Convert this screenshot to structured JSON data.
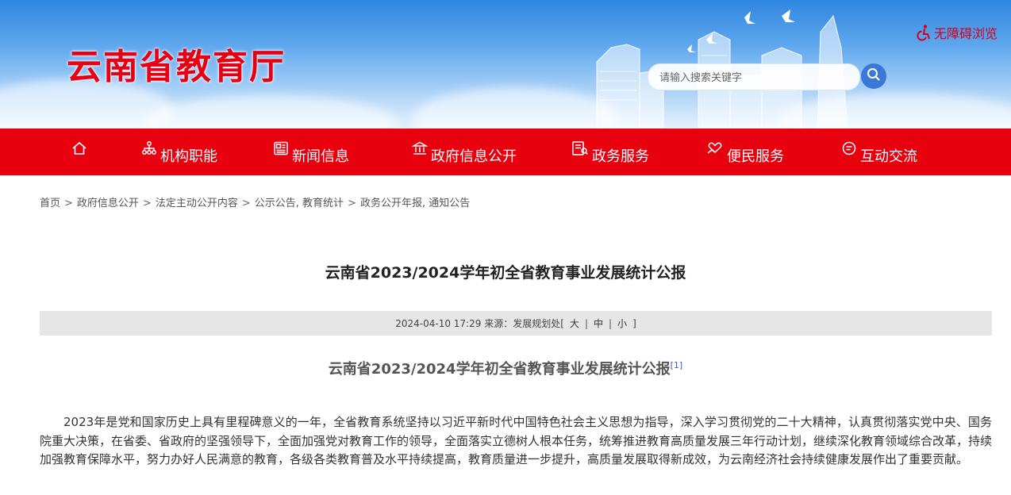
{
  "header": {
    "site_title": "云南省教育厅",
    "accessibility_label": "无障碍浏览",
    "search": {
      "placeholder": "请输入搜索关键字"
    }
  },
  "nav": {
    "items": [
      {
        "label": "",
        "icon": "home-icon"
      },
      {
        "label": "机构职能",
        "icon": "org-chart-icon"
      },
      {
        "label": "新闻信息",
        "icon": "news-icon"
      },
      {
        "label": "政府信息公开",
        "icon": "government-building-icon"
      },
      {
        "label": "政务服务",
        "icon": "service-document-icon"
      },
      {
        "label": "便民服务",
        "icon": "heart-hand-icon"
      },
      {
        "label": "互动交流",
        "icon": "chat-icon"
      }
    ]
  },
  "breadcrumb": {
    "separator": ">",
    "items": [
      "首页",
      "政府信息公开",
      "法定主动公开内容",
      "公示公告, 教育统计",
      "政务公开年报, 通知公告"
    ]
  },
  "article": {
    "title": "云南省2023/2024学年初全省教育事业发展统计公报",
    "meta": {
      "datetime": "2024-04-10 17:29",
      "source_label": "来源：",
      "source": "发展规划处",
      "font_bracket_open": "[",
      "font_large": "大",
      "font_medium": "中",
      "font_small": "小",
      "font_bracket_close": "]",
      "pipe": "|"
    },
    "subtitle": "云南省2023/2024学年初全省教育事业发展统计公报",
    "subtitle_footnote": "[1]",
    "paragraph": "2023年是党和国家历史上具有里程碑意义的一年，全省教育系统坚持以习近平新时代中国特色社会主义思想为指导，深入学习贯彻党的二十大精神，认真贯彻落实党中央、国务院重大决策，在省委、省政府的坚强领导下，全面加强党对教育工作的领导，全面落实立德树人根本任务，统筹推进教育高质量发展三年行动计划，继续深化教育领域综合改革，持续加强教育保障水平，努力办好人民满意的教育，各级各类教育普及水平持续提高，教育质量进一步提升，高质量发展取得新成效，为云南经济社会持续健康发展作出了重要贡献。"
  },
  "colors": {
    "nav_red": "#e8000e",
    "title_red": "#e60012",
    "search_button_blue": "#3a78d8",
    "meta_bar_gray": "#e6e6e6"
  }
}
